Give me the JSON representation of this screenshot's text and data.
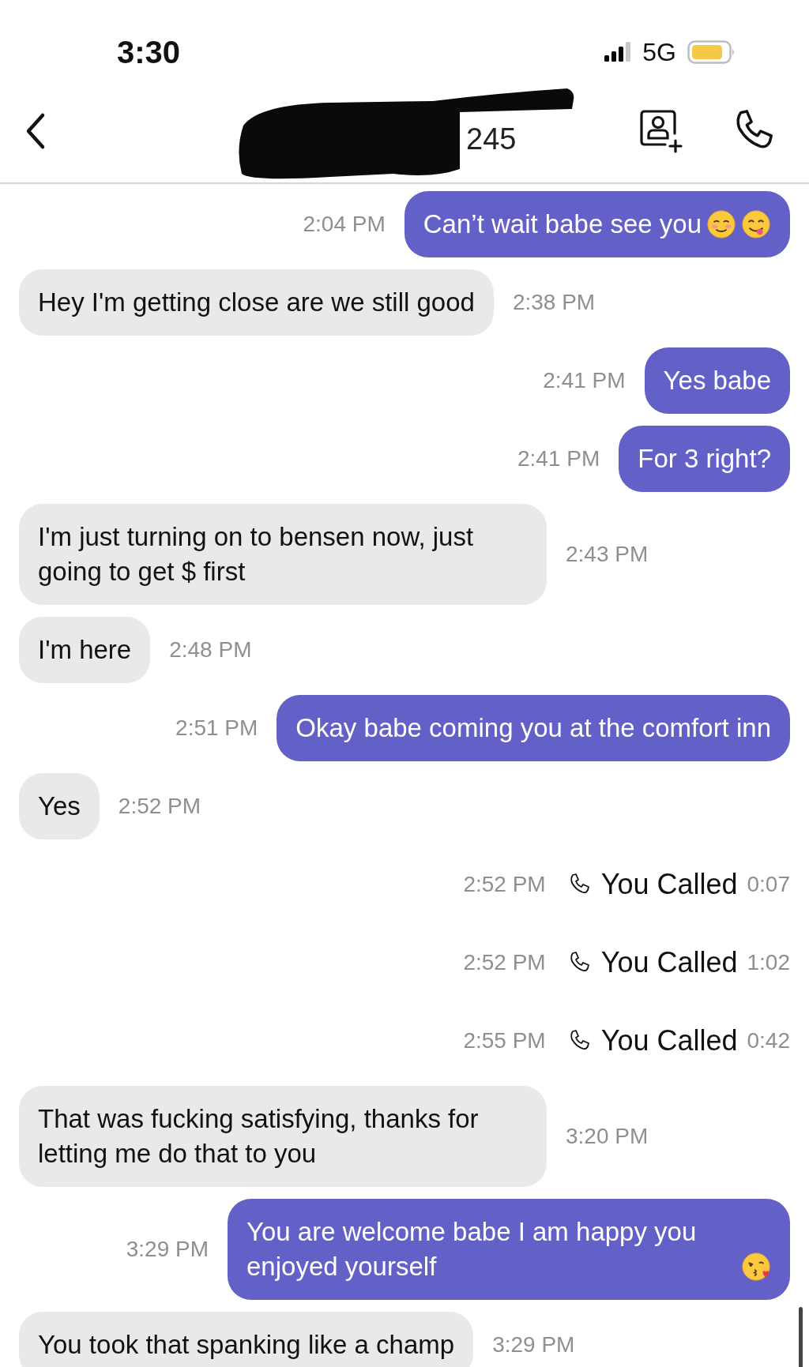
{
  "status_bar": {
    "time": "3:30",
    "network": "5G"
  },
  "header": {
    "title": "245",
    "redacted": true
  },
  "messages": [
    {
      "kind": "sent",
      "text": "Can’t wait babe see you",
      "emojis": [
        {
          "kind": "blush"
        },
        {
          "kind": "yum"
        }
      ],
      "time": "2:04 PM"
    },
    {
      "kind": "received",
      "text": "Hey I'm getting close are we still good",
      "time": "2:38 PM"
    },
    {
      "kind": "sent",
      "text": "Yes babe",
      "time": "2:41 PM"
    },
    {
      "kind": "sent",
      "text": "For 3 right?",
      "time": "2:41 PM"
    },
    {
      "kind": "received",
      "text": "I'm just turning on to bensen now, just going to get $ first",
      "time": "2:43 PM"
    },
    {
      "kind": "received",
      "text": "I'm here",
      "time": "2:48 PM"
    },
    {
      "kind": "sent",
      "text": "Okay babe coming you at the comfort inn",
      "time": "2:51 PM"
    },
    {
      "kind": "received",
      "text": "Yes",
      "time": "2:52 PM"
    },
    {
      "kind": "call",
      "label": "You Called",
      "duration": "0:07",
      "time": "2:52 PM"
    },
    {
      "kind": "call",
      "label": "You Called",
      "duration": "1:02",
      "time": "2:52 PM"
    },
    {
      "kind": "call",
      "label": "You Called",
      "duration": "0:42",
      "time": "2:55 PM"
    },
    {
      "kind": "received",
      "text": "That was fucking satisfying, thanks for letting me do that to you",
      "time": "3:20 PM"
    },
    {
      "kind": "sent",
      "text": "You are welcome babe I am happy you enjoyed yourself",
      "emojis": [
        {
          "kind": "kiss"
        }
      ],
      "time": "3:29 PM"
    },
    {
      "kind": "received",
      "text": "You took that spanking like a champ",
      "time": "3:29 PM"
    }
  ]
}
